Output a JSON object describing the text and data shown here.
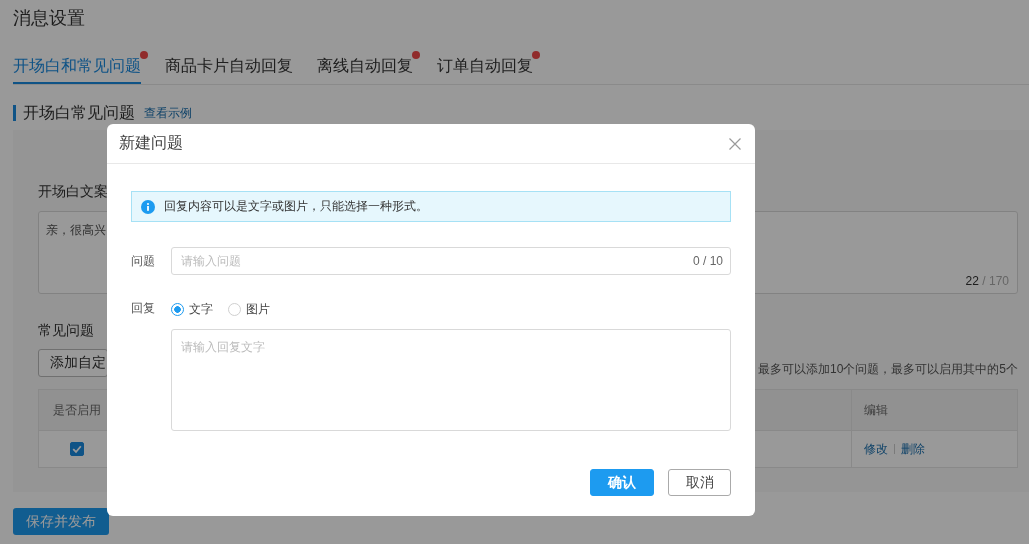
{
  "page": {
    "title": "消息设置"
  },
  "tabs": [
    {
      "label": "开场白和常见问题",
      "selected": true,
      "badge": true
    },
    {
      "label": "商品卡片自动回复",
      "selected": false,
      "badge": false
    },
    {
      "label": "离线自动回复",
      "selected": false,
      "badge": true
    },
    {
      "label": "订单自动回复",
      "selected": false,
      "badge": true
    }
  ],
  "section": {
    "title": "开场白常见问题",
    "link": "查看示例"
  },
  "greeting": {
    "label": "开场白文案",
    "value": "亲，很高兴",
    "count": "22",
    "limit": "/ 170"
  },
  "faq": {
    "label": "常见问题",
    "add_button": "添加自定",
    "note": "最多可以添加10个问题，最多可以启用其中的5个",
    "columns": [
      "是否启用",
      "编辑"
    ],
    "rows": [
      {
        "enabled": true,
        "actions": [
          "修改",
          "删除"
        ]
      }
    ]
  },
  "save_button": "保存并发布",
  "dialog": {
    "title": "新建问题",
    "alert": "回复内容可以是文字或图片，只能选择一种形式。",
    "question": {
      "label": "问题",
      "placeholder": "请输入问题",
      "counter": "0 / 10"
    },
    "reply": {
      "label": "回复",
      "options": [
        {
          "label": "文字",
          "selected": true
        },
        {
          "label": "图片",
          "selected": false
        }
      ],
      "placeholder": "请输入回复文字"
    },
    "buttons": [
      {
        "label": "确认",
        "kind": "primary"
      },
      {
        "label": "取消",
        "kind": "default"
      }
    ]
  }
}
